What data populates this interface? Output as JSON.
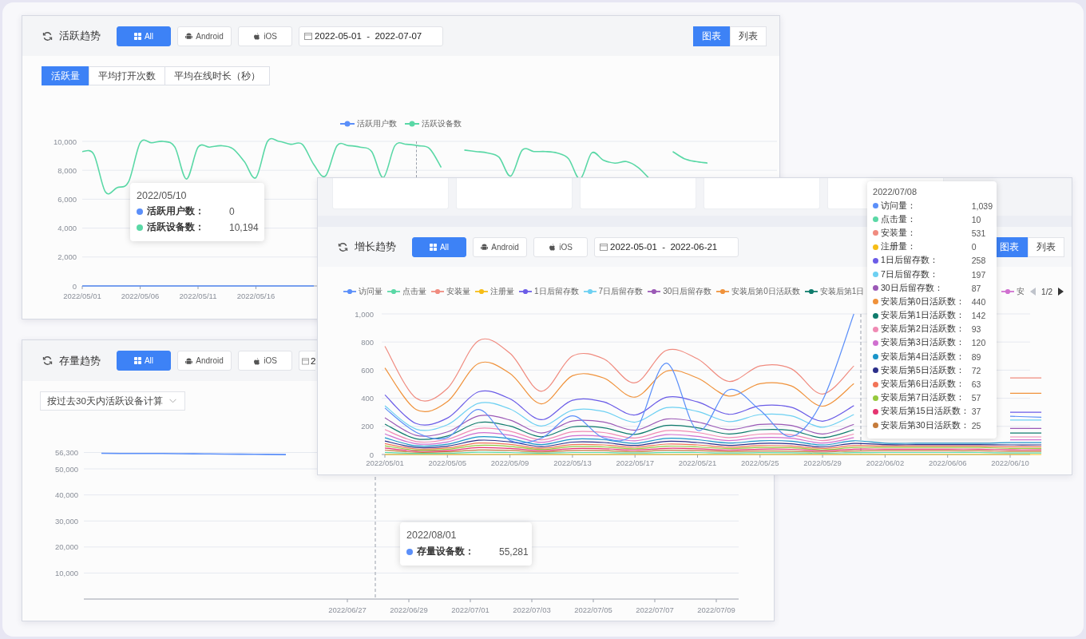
{
  "active_trend": {
    "header": {
      "title": "活跃趋势",
      "platforms": [
        {
          "label": "All",
          "selected": true
        },
        {
          "label": "Android",
          "selected": false
        },
        {
          "label": "iOS",
          "selected": false
        }
      ],
      "date_range": "2022-05-01  -  2022-07-07",
      "views": [
        {
          "label": "图表",
          "selected": true
        },
        {
          "label": "列表",
          "selected": false
        }
      ]
    },
    "metric_tabs": [
      {
        "label": "活跃量",
        "selected": true
      },
      {
        "label": "平均打开次数",
        "selected": false
      },
      {
        "label": "平均在线时长（秒）",
        "selected": false
      }
    ],
    "chart_data": {
      "type": "line",
      "grid": true,
      "categories": [
        "2022/05/01",
        null,
        null,
        null,
        null,
        "2022/05/06",
        null,
        null,
        null,
        null,
        "2022/05/11",
        null,
        null,
        null,
        null,
        "2022/05/16",
        null,
        null,
        null,
        null,
        null,
        null,
        null,
        null,
        null,
        null,
        null,
        null,
        null,
        null,
        null,
        null,
        null,
        null,
        null,
        null,
        null,
        null,
        null,
        null,
        null,
        null,
        null,
        null,
        null,
        null,
        null,
        null,
        null,
        null,
        null,
        null,
        null,
        null,
        null
      ],
      "series": [
        {
          "name": "活跃用户数",
          "color": "#5b8ff9",
          "values": [
            0,
            0,
            0,
            0,
            0,
            0,
            0,
            0,
            0,
            0,
            0,
            0,
            0,
            0,
            0,
            0,
            0,
            0,
            0,
            0,
            0,
            null,
            null,
            null,
            null,
            null,
            null,
            null,
            null,
            null,
            null,
            null,
            null,
            null,
            null,
            null,
            null,
            null,
            null,
            null,
            null,
            null,
            null,
            null,
            null,
            null,
            null,
            null,
            null,
            null,
            null,
            null,
            null,
            null,
            null
          ]
        },
        {
          "name": "活跃设备数",
          "color": "#5ad8a6",
          "values": [
            9300,
            9100,
            6500,
            6800,
            7200,
            9900,
            9900,
            10000,
            9600,
            7400,
            9600,
            9600,
            9700,
            9500,
            8600,
            7500,
            10000,
            10000,
            9800,
            9800,
            8400,
            7600,
            9700,
            9700,
            9600,
            9300,
            7500,
            9700,
            9800,
            9700,
            9500,
            8200,
            null,
            9400,
            9300,
            9200,
            8900,
            7600,
            9400,
            9300,
            9300,
            9200,
            8800,
            7400,
            9200,
            8700,
            8500,
            8600,
            8200,
            7400,
            null,
            9300,
            8800,
            8600,
            8500
          ]
        }
      ],
      "ylim": [
        0,
        10000
      ],
      "yticks": [
        {
          "value": 0,
          "label": "0"
        },
        {
          "value": 2000,
          "label": "2,000"
        },
        {
          "value": 4000,
          "label": "4,000"
        },
        {
          "value": 6000,
          "label": "6,000"
        },
        {
          "value": 8000,
          "label": "8,000"
        },
        {
          "value": 10000,
          "label": "10,000"
        }
      ]
    },
    "tooltip": {
      "title": "2022/05/10",
      "rows": [
        {
          "label": "活跃用户数：",
          "value": "0",
          "color": "#5b8ff9"
        },
        {
          "label": "活跃设备数：",
          "value": "10,194",
          "color": "#5ad8a6"
        }
      ]
    }
  },
  "stock_trend": {
    "header": {
      "title": "存量趋势",
      "platforms": [
        {
          "label": "All",
          "selected": true
        },
        {
          "label": "Android",
          "selected": false
        },
        {
          "label": "iOS",
          "selected": false
        }
      ],
      "date_range": "2"
    },
    "basis_select": {
      "value": "按过去30天内活跃设备计算"
    },
    "chart_data": {
      "type": "line",
      "grid": true,
      "categories": [
        null,
        null,
        null,
        null,
        null,
        null,
        null,
        null,
        "2022/06/27",
        null,
        "2022/06/29",
        null,
        "2022/07/01",
        null,
        "2022/07/03",
        null,
        "2022/07/05",
        null,
        "2022/07/07",
        null,
        "2022/07/09"
      ],
      "series": [
        {
          "color": "#5b8ff9",
          "values": [
            56000,
            55900,
            55900,
            55800,
            55700,
            55600,
            55500,
            null,
            null,
            null,
            null,
            null,
            null,
            null,
            null,
            null,
            null,
            null,
            null,
            null,
            null
          ]
        }
      ],
      "ylim": [
        0,
        56300
      ],
      "yticks": [
        {
          "value": 10000,
          "label": "10,000"
        },
        {
          "value": 20000,
          "label": "20,000"
        },
        {
          "value": 30000,
          "label": "30,000"
        },
        {
          "value": 40000,
          "label": "40,000"
        },
        {
          "value": 50000,
          "label": "50,000"
        },
        {
          "value": 56300,
          "label": "56,300"
        }
      ]
    },
    "tooltip": {
      "title": "2022/08/01",
      "rows": [
        {
          "label": "存量设备数：",
          "value": "55,281",
          "color": "#5b8ff9"
        }
      ]
    }
  },
  "growth_trend": {
    "header": {
      "title": "增长趋势",
      "platforms": [
        {
          "label": "All",
          "selected": true
        },
        {
          "label": "Android",
          "selected": false
        },
        {
          "label": "iOS",
          "selected": false
        }
      ],
      "date_range": "2022-05-01  -  2022-06-21",
      "views": [
        {
          "label": "图表",
          "selected": true
        },
        {
          "label": "列表",
          "selected": false
        }
      ]
    },
    "legend": {
      "items": [
        {
          "label": "访问量",
          "color": "#5b8ff9"
        },
        {
          "label": "点击量",
          "color": "#5ad8a6"
        },
        {
          "label": "安装量",
          "color": "#f08b7f"
        },
        {
          "label": "注册量",
          "color": "#f6bd16"
        },
        {
          "label": "1日后留存数",
          "color": "#6b5ce7"
        },
        {
          "label": "7日后留存数",
          "color": "#6dd0f2"
        },
        {
          "label": "30日后留存数",
          "color": "#9b59b6"
        },
        {
          "label": "安装后第0日活跃数",
          "color": "#f0923b"
        },
        {
          "label": "安装后第1日",
          "color": "#0f7b6c"
        }
      ],
      "overflow_item": {
        "label": "安",
        "color": "#d070d0"
      },
      "pager": {
        "text": "1/2",
        "prev_disabled": true,
        "next_disabled": false
      }
    },
    "chart_data": {
      "type": "line",
      "grid": true,
      "categories": [
        "2022/05/01",
        null,
        "2022/05/05",
        null,
        "2022/05/09",
        null,
        "2022/05/13",
        null,
        "2022/05/17",
        null,
        "2022/05/21",
        null,
        "2022/05/25",
        null,
        "2022/05/29",
        null,
        "2022/06/02",
        null,
        "2022/06/06",
        null,
        "2022/06/10",
        null
      ],
      "series": [
        {
          "color": "#5b8ff9",
          "values": [
            330,
            158,
            120,
            320,
            100,
            115,
            275,
            117,
            158,
            650,
            172,
            460,
            315,
            128,
            385,
            1000,
            null,
            null,
            null,
            null,
            272,
            265
          ]
        },
        {
          "color": "#5ad8a6",
          "values": [
            15,
            8,
            9,
            16,
            14,
            9,
            14,
            14,
            10,
            15,
            14,
            10,
            13,
            12,
            9,
            13,
            14,
            14,
            14,
            14,
            11,
            11
          ]
        },
        {
          "color": "#f08b7f",
          "values": [
            770,
            400,
            470,
            810,
            720,
            450,
            700,
            680,
            510,
            740,
            680,
            520,
            630,
            610,
            430,
            630,
            null,
            null,
            null,
            null,
            545,
            545
          ]
        },
        {
          "color": "#f6bd16",
          "values": [
            0,
            0,
            0,
            0,
            0,
            0,
            0,
            0,
            0,
            0,
            0,
            0,
            0,
            0,
            0,
            0,
            0,
            0,
            0,
            0,
            0,
            0
          ]
        },
        {
          "color": "#6b5ce7",
          "values": [
            424,
            220,
            259,
            446,
            396,
            248,
            385,
            374,
            281,
            407,
            374,
            286,
            347,
            336,
            237,
            347,
            null,
            null,
            null,
            null,
            300,
            300
          ]
        },
        {
          "color": "#6dd0f2",
          "values": [
            347,
            180,
            212,
            365,
            324,
            203,
            315,
            306,
            230,
            333,
            306,
            234,
            284,
            275,
            194,
            284,
            null,
            null,
            null,
            null,
            245,
            245
          ]
        },
        {
          "color": "#9b59b6",
          "values": [
            262,
            136,
            160,
            275,
            245,
            153,
            238,
            231,
            173,
            252,
            231,
            177,
            214,
            207,
            146,
            214,
            null,
            null,
            null,
            null,
            185,
            185
          ]
        },
        {
          "color": "#f0923b",
          "values": [
            616,
            320,
            376,
            648,
            576,
            360,
            560,
            544,
            408,
            592,
            544,
            416,
            504,
            488,
            344,
            504,
            null,
            null,
            null,
            null,
            436,
            436
          ]
        },
        {
          "color": "#0f7b6c",
          "values": [
            216,
            112,
            132,
            227,
            202,
            126,
            196,
            190,
            143,
            207,
            190,
            146,
            176,
            171,
            120,
            176,
            null,
            null,
            null,
            null,
            153,
            153
          ]
        },
        {
          "color": "#f08bb4",
          "values": [
            177,
            92,
            108,
            186,
            166,
            104,
            161,
            156,
            117,
            170,
            156,
            120,
            145,
            140,
            99,
            145,
            null,
            null,
            null,
            null,
            125,
            125
          ]
        },
        {
          "color": "#d070d0",
          "values": [
            146,
            76,
            89,
            154,
            137,
            86,
            133,
            129,
            97,
            141,
            129,
            99,
            120,
            116,
            82,
            120,
            null,
            null,
            null,
            null,
            104,
            104
          ]
        },
        {
          "color": "#1a95c9",
          "values": [
            119,
            62,
            73,
            126,
            112,
            70,
            109,
            105,
            79,
            115,
            105,
            81,
            98,
            95,
            67,
            98,
            80,
            80,
            80,
            80,
            84,
            84
          ]
        },
        {
          "color": "#2c2f8a",
          "values": [
            96,
            50,
            59,
            101,
            90,
            56,
            88,
            85,
            64,
            93,
            85,
            65,
            79,
            76,
            54,
            79,
            70,
            70,
            70,
            70,
            68,
            68
          ]
        },
        {
          "color": "#f27458",
          "values": [
            77,
            40,
            47,
            81,
            72,
            45,
            70,
            68,
            51,
            74,
            68,
            52,
            63,
            61,
            43,
            63,
            60,
            60,
            60,
            60,
            55,
            55
          ]
        },
        {
          "color": "#96c93d",
          "values": [
            62,
            32,
            38,
            65,
            58,
            36,
            56,
            54,
            41,
            59,
            54,
            42,
            50,
            49,
            34,
            50,
            50,
            50,
            50,
            50,
            44,
            44
          ]
        },
        {
          "color": "#e53470",
          "values": [
            46,
            24,
            28,
            49,
            43,
            27,
            42,
            41,
            31,
            44,
            41,
            31,
            38,
            37,
            26,
            38,
            38,
            38,
            38,
            38,
            33,
            33
          ]
        },
        {
          "color": "#c57b3b",
          "values": [
            31,
            16,
            19,
            32,
            29,
            18,
            28,
            27,
            20,
            30,
            27,
            21,
            25,
            24,
            17,
            25,
            26,
            26,
            26,
            26,
            22,
            22
          ]
        }
      ],
      "ylim": [
        0,
        1000
      ],
      "yticks": [
        {
          "value": 0,
          "label": "0"
        },
        {
          "value": 200,
          "label": "200"
        },
        {
          "value": 400,
          "label": "400"
        },
        {
          "value": 600,
          "label": "600"
        },
        {
          "value": 800,
          "label": "800"
        },
        {
          "value": 1000,
          "label": "1,000"
        }
      ]
    },
    "tooltip": {
      "title": "2022/07/08",
      "rows": [
        {
          "label": "访问量：",
          "value": "1,039",
          "color": "#5b8ff9"
        },
        {
          "label": "点击量：",
          "value": "10",
          "color": "#5ad8a6"
        },
        {
          "label": "安装量：",
          "value": "531",
          "color": "#f08b7f"
        },
        {
          "label": "注册量：",
          "value": "0",
          "color": "#f6bd16"
        },
        {
          "label": "1日后留存数：",
          "value": "258",
          "color": "#6b5ce7"
        },
        {
          "label": "7日后留存数：",
          "value": "197",
          "color": "#6dd0f2"
        },
        {
          "label": "30日后留存数：",
          "value": "87",
          "color": "#9b59b6"
        },
        {
          "label": "安装后第0日活跃数：",
          "value": "440",
          "color": "#f0923b"
        },
        {
          "label": "安装后第1日活跃数：",
          "value": "142",
          "color": "#0f7b6c"
        },
        {
          "label": "安装后第2日活跃数：",
          "value": "93",
          "color": "#f08bb4"
        },
        {
          "label": "安装后第3日活跃数：",
          "value": "120",
          "color": "#d070d0"
        },
        {
          "label": "安装后第4日活跃数：",
          "value": "89",
          "color": "#1a95c9"
        },
        {
          "label": "安装后第5日活跃数：",
          "value": "72",
          "color": "#2c2f8a"
        },
        {
          "label": "安装后第6日活跃数：",
          "value": "63",
          "color": "#f27458"
        },
        {
          "label": "安装后第7日活跃数：",
          "value": "57",
          "color": "#96c93d"
        },
        {
          "label": "安装后第15日活跃数：",
          "value": "37",
          "color": "#e53470"
        },
        {
          "label": "安装后第30日活跃数：",
          "value": "25",
          "color": "#c57b3b"
        }
      ]
    }
  }
}
